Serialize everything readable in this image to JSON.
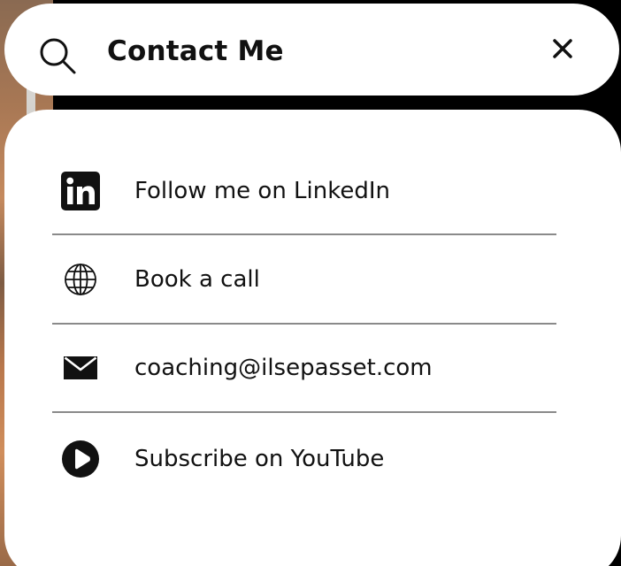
{
  "search": {
    "title": "Contact Me",
    "search_icon": "search-icon",
    "close_icon": "close-icon"
  },
  "contacts": [
    {
      "label": "Follow me on LinkedIn",
      "icon": "linkedin-icon"
    },
    {
      "label": "Book a call",
      "icon": "globe-icon"
    },
    {
      "label": "coaching@ilsepasset.com",
      "icon": "mail-icon"
    },
    {
      "label": "Subscribe on YouTube",
      "icon": "play-icon"
    }
  ],
  "colors": {
    "panel": "#ffffff",
    "text": "#111111",
    "divider": "#8a8a8a",
    "backdrop": "#000000"
  }
}
